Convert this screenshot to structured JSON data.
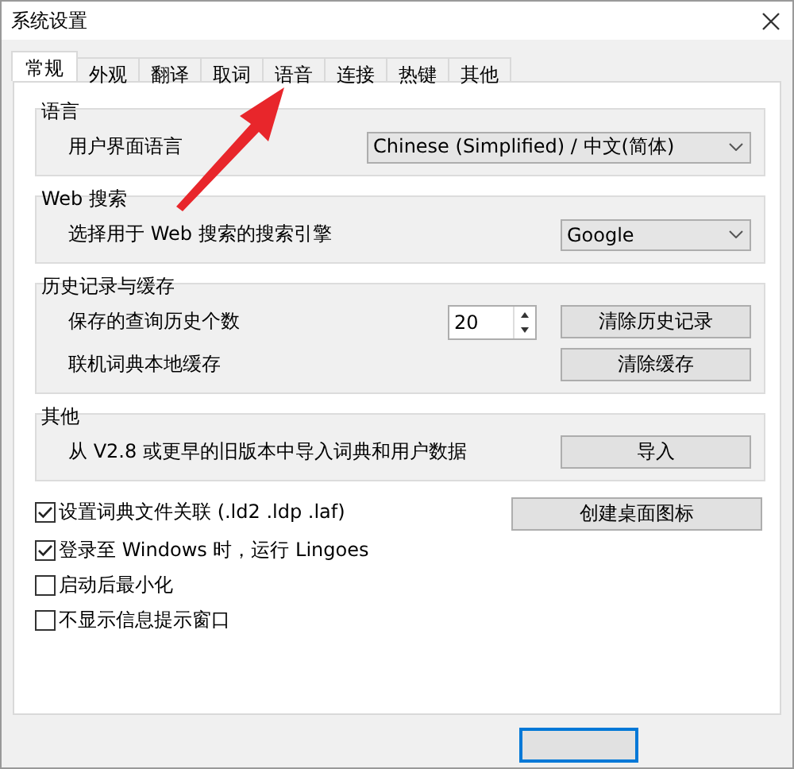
{
  "window": {
    "title": "系统设置"
  },
  "tabs": [
    {
      "label": "常规",
      "selected": true
    },
    {
      "label": "外观",
      "selected": false
    },
    {
      "label": "翻译",
      "selected": false
    },
    {
      "label": "取词",
      "selected": false
    },
    {
      "label": "语音",
      "selected": false
    },
    {
      "label": "连接",
      "selected": false
    },
    {
      "label": "热键",
      "selected": false
    },
    {
      "label": "其他",
      "selected": false
    }
  ],
  "groups": [
    {
      "title": "语言",
      "rows": [
        {
          "label": "用户界面语言",
          "dropdown": "Chinese (Simplified)  /  中文(简体)"
        }
      ]
    },
    {
      "title": "Web 搜索",
      "rows": [
        {
          "label": "选择用于 Web 搜索的搜索引擎",
          "dropdown": "Google"
        }
      ]
    },
    {
      "title": "历史记录与缓存",
      "rows": [
        {
          "label": "保存的查询历史个数",
          "spinner": "20",
          "button": "清除历史记录"
        },
        {
          "label": "联机词典本地缓存",
          "button": "清除缓存"
        }
      ]
    },
    {
      "title": "其他",
      "rows": [
        {
          "label": "从 V2.8 或更早的旧版本中导入词典和用户数据",
          "button": "导入"
        }
      ]
    }
  ],
  "checkboxes": [
    {
      "label": "设置词典文件关联 (.ld2 .ldp .laf)",
      "checked": true
    },
    {
      "label": "登录至 Windows 时，运行 Lingoes",
      "checked": true
    },
    {
      "label": "启动后最小化",
      "checked": false
    },
    {
      "label": "不显示信息提示窗口",
      "checked": false
    }
  ],
  "side_button": "创建桌面图标"
}
